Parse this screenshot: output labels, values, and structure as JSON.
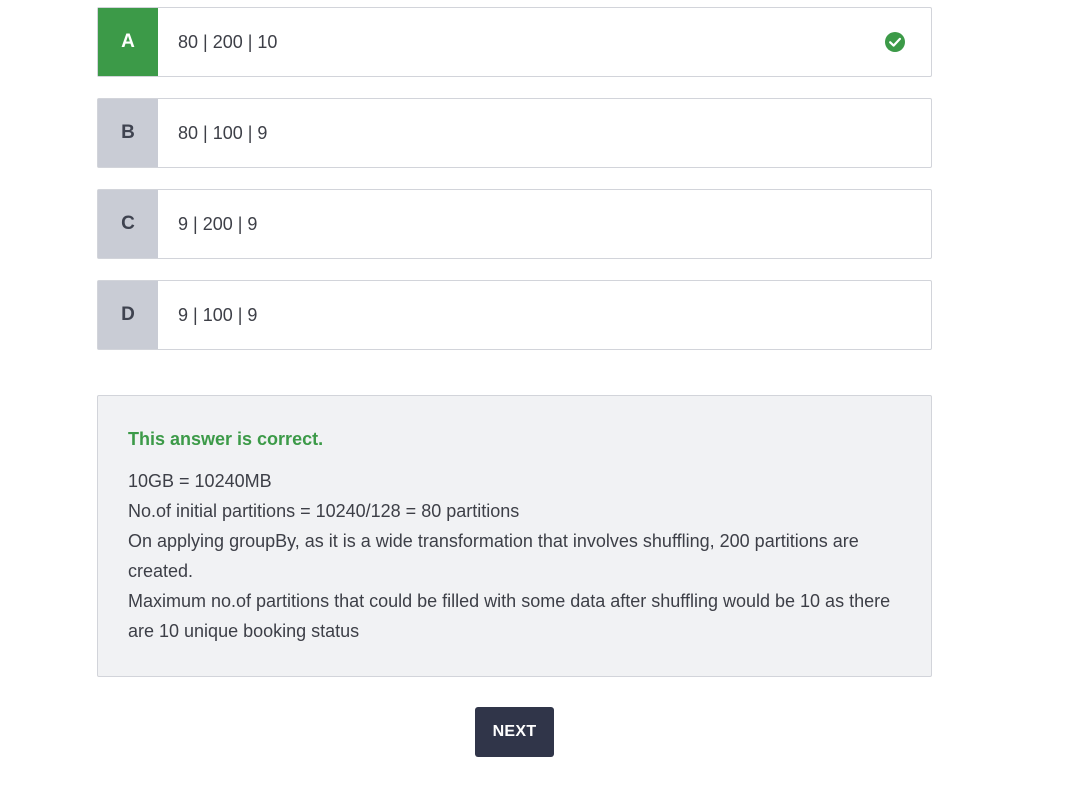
{
  "options": [
    {
      "letter": "A",
      "text": "80 | 200 | 10",
      "correct": true
    },
    {
      "letter": "B",
      "text": "80 | 100 | 9",
      "correct": false
    },
    {
      "letter": "C",
      "text": "9 | 200 | 9",
      "correct": false
    },
    {
      "letter": "D",
      "text": "9 | 100 | 9",
      "correct": false
    }
  ],
  "feedback": {
    "verdict": "This answer is correct.",
    "lines": [
      "10GB = 10240MB",
      "No.of initial partitions = 10240/128 = 80 partitions",
      "On applying groupBy, as it is a wide transformation that involves shuffling, 200 partitions are created.",
      "Maximum no.of partitions that could be filled with some data after shuffling would be 10 as there are 10 unique booking status"
    ]
  },
  "buttons": {
    "next_label": "NEXT"
  },
  "colors": {
    "correct_green": "#3c9a48",
    "letter_gray": "#c9ccd5",
    "button_dark": "#303549",
    "feedback_bg": "#f1f2f4"
  },
  "icons": {
    "correct": "check-circle-icon"
  }
}
